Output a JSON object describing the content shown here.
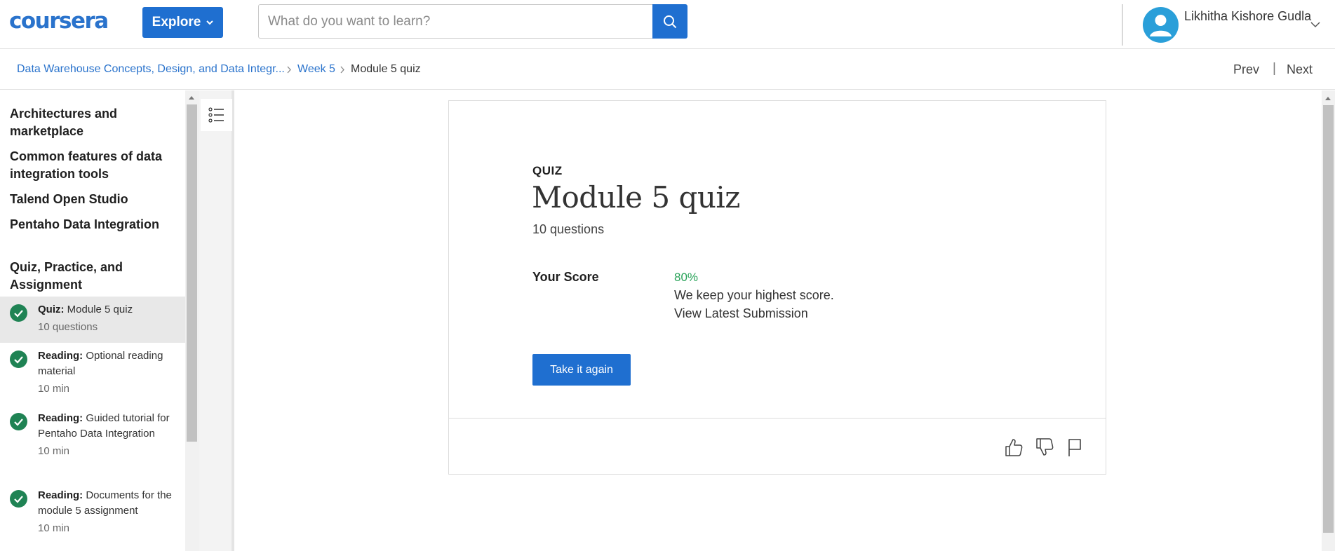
{
  "header": {
    "logo": "coursera",
    "explore_label": "Explore",
    "search_placeholder": "What do you want to learn?",
    "user_name": "Likhitha Kishore Gudla",
    "brand_color": "#1f6fd0"
  },
  "breadcrumb": {
    "course": "Data Warehouse Concepts, Design, and Data Integr...",
    "week": "Week 5",
    "current": "Module 5 quiz",
    "prev": "Prev",
    "separator": "|",
    "next": "Next"
  },
  "sidebar": {
    "sections": [
      "Architectures and marketplace",
      "Common features of data integration tools",
      "Talend Open Studio",
      "Pentaho Data Integration",
      "Quiz, Practice, and Assignment"
    ],
    "items": [
      {
        "type": "Quiz:",
        "title": "Module 5 quiz",
        "meta": "10 questions",
        "active": true,
        "completed": true
      },
      {
        "type": "Reading:",
        "title": "Optional reading material",
        "meta": "10 min",
        "active": false,
        "completed": true
      },
      {
        "type": "Reading:",
        "title": "Guided tutorial for Pentaho Data Integration",
        "meta": "10 min",
        "active": false,
        "completed": true
      },
      {
        "type": "Reading:",
        "title": "Documents for the module 5 assignment",
        "meta": "10 min",
        "active": false,
        "completed": true
      }
    ]
  },
  "quiz": {
    "label": "QUIZ",
    "title": "Module 5 quiz",
    "subtitle": "10 questions",
    "score_label": "Your Score",
    "score_value": "80%",
    "score_note": "We keep your highest score.",
    "view_submission": "View Latest Submission",
    "retake_label": "Take it again",
    "success_color": "#2aa35a"
  },
  "feedback": {
    "icons": [
      "thumbs-up-icon",
      "thumbs-down-icon",
      "flag-icon"
    ]
  }
}
